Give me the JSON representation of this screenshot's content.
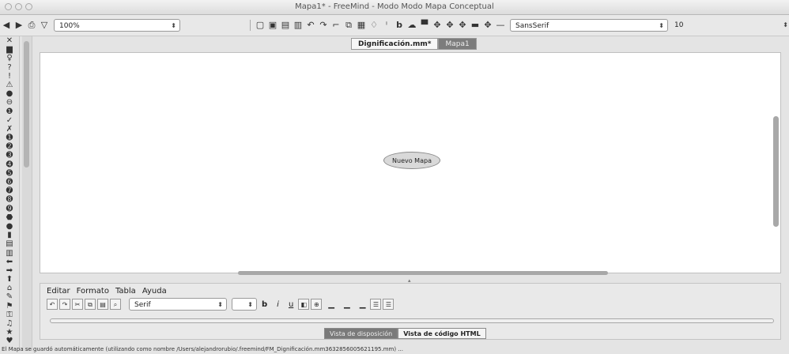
{
  "window": {
    "title": "Mapa1* - FreeMind - Modo Modo Mapa Conceptual"
  },
  "toolbar": {
    "zoom_value": "100%",
    "font_family": "SansSerif",
    "font_size": "10",
    "icons": [
      "back-icon",
      "forward-icon",
      "print-icon",
      "filter-icon",
      "new-file-icon",
      "open-file-icon",
      "save-icon",
      "save-as-icon",
      "undo-icon",
      "redo-icon",
      "cut-icon",
      "copy-icon",
      "paste-icon",
      "idea-icon",
      "info-icon",
      "bold-icon",
      "italic-icon",
      "cloud-icon",
      "edge-up-icon",
      "edge-down-icon",
      "edge-left-icon",
      "edge-right-icon",
      "line-icon"
    ]
  },
  "tabs": [
    {
      "label": "Dignificación.mm*"
    },
    {
      "label": "Mapa1"
    }
  ],
  "map": {
    "root_node": "Nuevo Mapa"
  },
  "editor": {
    "menu": [
      "Editar",
      "Formato",
      "Tabla",
      "Ayuda"
    ],
    "font": "Serif"
  },
  "view_tabs": [
    "Vista de disposición",
    "Vista de código HTML"
  ],
  "status": "El Mapa se guardó automáticamente (utilizando como nombre /Users/alejandrorubio/.freemind/FM_Digniﬁcación.mm3632856005621195.mm) ..."
}
